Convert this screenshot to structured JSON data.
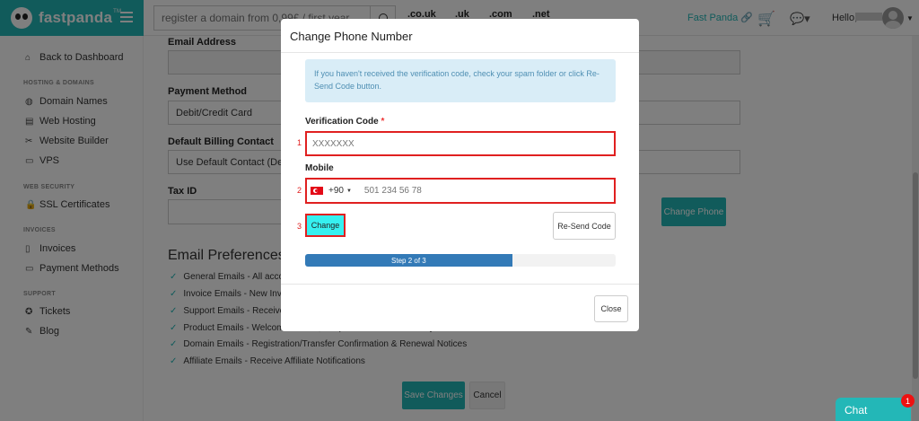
{
  "header": {
    "brand": "fastpanda",
    "brand_tm": "TM",
    "search_placeholder": "register a domain from 0,99£ / first year",
    "tlds": [
      ".co.uk",
      ".uk",
      ".com",
      ".net"
    ],
    "company_link": "Fast Panda",
    "greeting": "Hello,"
  },
  "sidebar": {
    "back": "Back to Dashboard",
    "sections": [
      {
        "title": "HOSTING & DOMAINS",
        "items": [
          "Domain Names",
          "Web Hosting",
          "Website Builder",
          "VPS"
        ]
      },
      {
        "title": "WEB SECURITY",
        "items": [
          "SSL Certificates"
        ]
      },
      {
        "title": "INVOICES",
        "items": [
          "Invoices",
          "Payment Methods"
        ]
      },
      {
        "title": "SUPPORT",
        "items": [
          "Tickets",
          "Blog"
        ]
      }
    ]
  },
  "form": {
    "email_label": "Email Address",
    "payment_label": "Payment Method",
    "payment_value": "Debit/Credit Card",
    "billing_label": "Default Billing Contact",
    "billing_value": "Use Default Contact (Details Above)",
    "tax_label": "Tax ID",
    "change_phone": "Change Phone"
  },
  "email_prefs": {
    "title": "Email Preferences",
    "items": [
      "General Emails - All account related emails",
      "Invoice Emails - New Invoices, Reminders, & Overdue Notices",
      "Support Emails - Receive a copy of all Support Ticket Communications",
      "Product Emails - Welcome Emails, Suspensions & Other Lifecycle Notifications",
      "Domain Emails - Registration/Transfer Confirmation & Renewal Notices",
      "Affiliate Emails - Receive Affiliate Notifications"
    ],
    "save": "Save Changes",
    "cancel": "Cancel"
  },
  "modal": {
    "title": "Change Phone Number",
    "info": "If you haven't received the verification code, check your spam folder or click Re-Send Code button.",
    "code_label": "Verification Code",
    "required_mark": "*",
    "code_placeholder": "XXXXXXX",
    "mobile_label": "Mobile",
    "country_code": "+90",
    "phone_placeholder": "501 234 56 78",
    "change": "Change",
    "resend": "Re-Send Code",
    "progress_text": "Step 2 of 3",
    "progress_fraction": 0.667,
    "close": "Close",
    "markers": [
      "1",
      "2",
      "3"
    ]
  },
  "chat": {
    "label": "Chat",
    "badge": "1"
  },
  "colors": {
    "brand": "#23b7b7",
    "progress": "#337ab7",
    "highlight": "#e02020"
  }
}
